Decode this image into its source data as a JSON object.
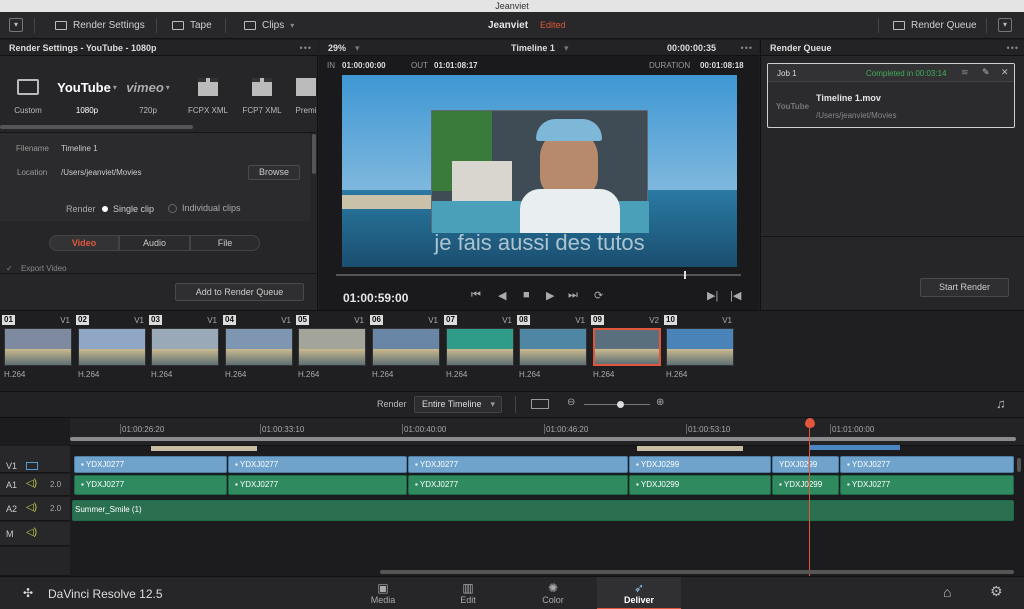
{
  "window": {
    "title": "Jeanviet"
  },
  "toolbar": {
    "render_settings": "Render Settings",
    "tape": "Tape",
    "clips": "Clips",
    "project": "Jeanviet",
    "project_status": "Edited",
    "render_queue": "Render Queue"
  },
  "left_panel": {
    "title": "Render Settings - YouTube - 1080p",
    "presets": [
      {
        "name": "Custom"
      },
      {
        "name": "1080p",
        "brand": "YouTube"
      },
      {
        "name": "720p",
        "brand": "vimeo"
      },
      {
        "name": "FCPX XML"
      },
      {
        "name": "FCP7 XML"
      },
      {
        "name": "Premi"
      }
    ],
    "filename_label": "Filename",
    "filename_value": "Timeline 1",
    "location_label": "Location",
    "location_value": "/Users/jeanviet/Movies",
    "browse": "Browse",
    "render_label": "Render",
    "single_clip": "Single clip",
    "individual_clips": "Individual clips",
    "tabs": [
      "Video",
      "Audio",
      "File"
    ],
    "export_video": "Export Video",
    "add_to_queue": "Add to Render Queue"
  },
  "viewer": {
    "zoom": "29%",
    "timeline_name": "Timeline 1",
    "top_timecode": "00:00:00:35",
    "in_label": "IN",
    "in_value": "01:00:00:00",
    "out_label": "OUT",
    "out_value": "01:01:08:17",
    "duration_label": "DURATION",
    "duration_value": "00:01:08:18",
    "subtitle": "je fais aussi des tutos",
    "current_timecode": "01:00:59:00",
    "scrub_position": 0.86
  },
  "queue": {
    "title": "Render Queue",
    "job_title": "Job 1",
    "job_status": "Completed in 00:03:14",
    "job_brand": "YouTube",
    "job_file": "Timeline 1.mov",
    "job_path": "/Users/jeanviet/Movies",
    "start_render": "Start Render"
  },
  "clips": [
    {
      "num": "01",
      "track": "V1",
      "codec": "H.264",
      "color": "#7d8aa0"
    },
    {
      "num": "02",
      "track": "V1",
      "codec": "H.264",
      "color": "#8fa7c4"
    },
    {
      "num": "03",
      "track": "V1",
      "codec": "H.264",
      "color": "#9aa9b8"
    },
    {
      "num": "04",
      "track": "V1",
      "codec": "H.264",
      "color": "#7f96b3"
    },
    {
      "num": "05",
      "track": "V1",
      "codec": "H.264",
      "color": "#a3a49a"
    },
    {
      "num": "06",
      "track": "V1",
      "codec": "H.264",
      "color": "#6a86a6"
    },
    {
      "num": "07",
      "track": "V1",
      "codec": "H.264",
      "color": "#2f9c8a"
    },
    {
      "num": "08",
      "track": "V1",
      "codec": "H.264",
      "color": "#4f86a3"
    },
    {
      "num": "09",
      "track": "V2",
      "codec": "H.264",
      "color": "#5a6f7e",
      "selected": true
    },
    {
      "num": "10",
      "track": "V1",
      "codec": "H.264",
      "color": "#4a83b8"
    }
  ],
  "render_bar": {
    "label": "Render",
    "scope": "Entire Timeline",
    "zoom_position": 0.55
  },
  "timeline": {
    "ruler": [
      "01:00:26:20",
      "01:00:33:10",
      "01:00:40:00",
      "01:00:46:20",
      "01:00:53:10",
      "01:01:00:00"
    ],
    "tracks": [
      {
        "name": "V1"
      },
      {
        "name": "A1",
        "level": "2.0"
      },
      {
        "name": "A2",
        "level": "2.0"
      },
      {
        "name": "M"
      }
    ],
    "v1_clips": [
      "YDXJ0277",
      "YDXJ0277",
      "YDXJ0277",
      "YDXJ0299",
      "YDXJ0299",
      "YDXJ0277"
    ],
    "a1_clips": [
      "YDXJ0277",
      "YDXJ0277",
      "YDXJ0277",
      "YDXJ0299",
      "YDXJ0299",
      "YDXJ0277"
    ],
    "a2_clip": "Summer_Smile (1)"
  },
  "bottom": {
    "app_name": "DaVinci Resolve 12.5",
    "pages": [
      "Media",
      "Edit",
      "Color",
      "Deliver"
    ],
    "active_page": "Deliver"
  },
  "colors": {
    "accent": "#e2563b",
    "video_clip": "#6fa3cc",
    "audio_clip": "#2f8a60",
    "status_ok": "#3fae5a"
  }
}
